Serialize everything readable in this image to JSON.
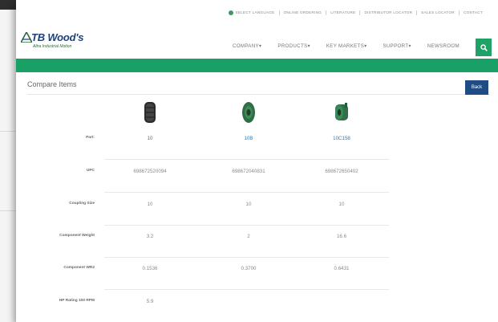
{
  "utility_bar": {
    "items": [
      "SELECT LANGUAGE",
      "ONLINE ORDERING",
      "LITERATURE",
      "DISTRIBUTOR LOCATOR",
      "SALES LOCATOR",
      "CONTACT"
    ]
  },
  "brand": {
    "name": "TB Wood's",
    "tagline": "Altra Industrial Motion",
    "colors": {
      "primary_green": "#18a067",
      "navy": "#1e4d86",
      "logo_blue": "#1d3f7a"
    }
  },
  "nav": {
    "items": [
      "COMPANY",
      "PRODUCTS",
      "KEY MARKETS",
      "SUPPORT",
      "NEWSROOM"
    ],
    "search_icon": "search-icon"
  },
  "compare": {
    "title": "Compare Items",
    "back_label": "Back"
  },
  "products": [
    {
      "part": "10",
      "upc": "698672520094",
      "coupling_size": "10",
      "component_weight": "3.2",
      "component_wr2": "0.1536",
      "hp_rating_100_rpm": "5.9",
      "image": "black-coupling"
    },
    {
      "part": "10B",
      "upc": "698672040831",
      "coupling_size": "10",
      "component_weight": "2",
      "component_wr2": "0.3700",
      "hp_rating_100_rpm": "",
      "image": "green-bushing"
    },
    {
      "part": "10C158",
      "upc": "698672650402",
      "coupling_size": "10",
      "component_weight": "16.6",
      "component_wr2": "0.6431",
      "hp_rating_100_rpm": "",
      "image": "green-hub"
    }
  ],
  "row_labels": {
    "part": "Part:",
    "upc": "UPC",
    "coupling_size": "Coupling Size",
    "component_weight": "Component Weight",
    "component_wr2": "Component WR2",
    "hp_rating": "HP Rating 100 RPM"
  }
}
